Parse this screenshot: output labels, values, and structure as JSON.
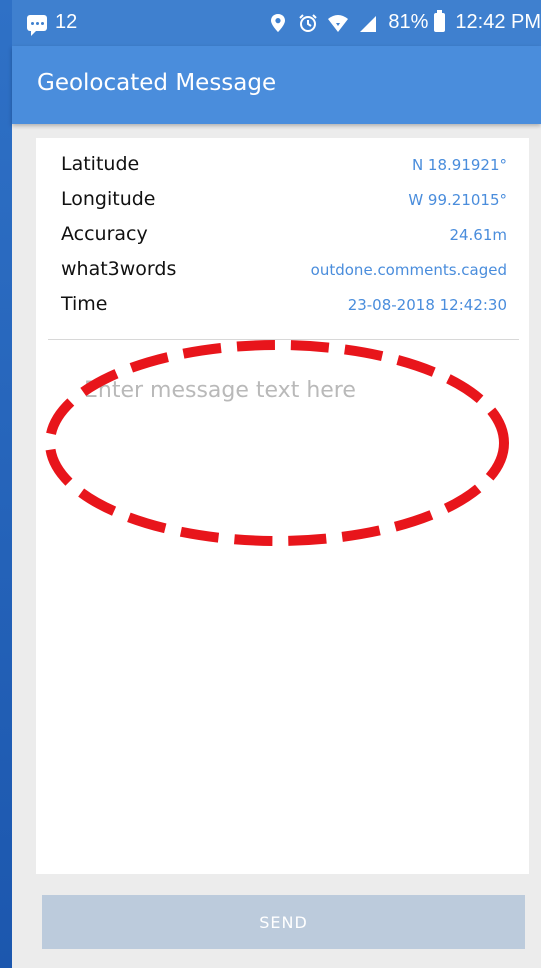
{
  "status_bar": {
    "notification_count": "12",
    "battery": "81%",
    "time": "12:42 PM",
    "icons": [
      "message-icon",
      "location-pin-icon",
      "alarm-icon",
      "wifi-icon",
      "signal-icon",
      "battery-icon"
    ]
  },
  "app_bar": {
    "title": "Geolocated Message"
  },
  "location_info": {
    "rows": [
      {
        "label": "Latitude",
        "value": "N 18.91921°"
      },
      {
        "label": "Longitude",
        "value": "W 99.21015°"
      },
      {
        "label": "Accuracy",
        "value": "24.61m"
      },
      {
        "label": "what3words",
        "value": "outdone.comments.caged"
      },
      {
        "label": "Time",
        "value": "23-08-2018 12:42:30"
      }
    ]
  },
  "message": {
    "value": "",
    "placeholder": "Enter message text here"
  },
  "actions": {
    "send_label": "SEND"
  },
  "colors": {
    "accent": "#4a8ddc",
    "status_bar": "#3f80cf",
    "annotation": "#e8151b",
    "send_disabled": "#bccbdc"
  }
}
